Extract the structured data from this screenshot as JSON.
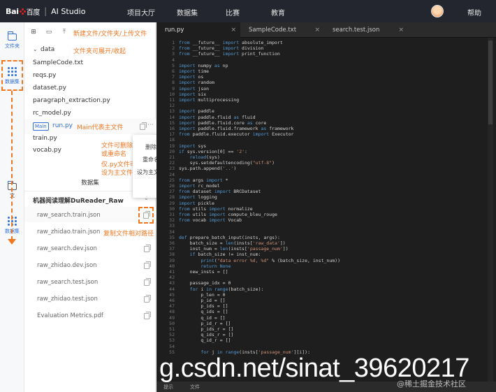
{
  "topbar": {
    "logo_text": "Bai",
    "logo_cn": "百度",
    "product": "AI Studio",
    "nav": [
      "项目大厅",
      "数据集",
      "比赛",
      "教育"
    ],
    "help": "帮助"
  },
  "rail": {
    "files_label": "文件夹",
    "dataset_label": "数据集",
    "files_label_2": "文",
    "dataset_label_2": "数据集"
  },
  "files": {
    "toolbar_note": "新建文件/文件夹/上传文件",
    "folder_name": "data",
    "folder_note": "文件夹可展开/收起",
    "items": [
      "SampleCode.txt",
      "reqs.py",
      "dataset.py",
      "paragraph_extraction.py",
      "rc_model.py"
    ],
    "main_badge": "Main",
    "main_file": "run.py",
    "main_note": "Main代表主文件",
    "items_after": [
      "train.py",
      "vocab.py"
    ],
    "rename_note": "文件可删除\n或重命名",
    "setmain_note": "仅.py文件可以\n设为主文件",
    "context_menu": [
      "删除",
      "重命名",
      "设为主文件"
    ],
    "dataset_header": "数据集",
    "dataset_name": "机器阅读理解DuReader_Raw",
    "dataset_files": [
      "raw_search.train.json",
      "raw_zhidao.train.json",
      "raw_search.dev.json",
      "raw_zhidao.dev.json",
      "raw_search.test.json",
      "raw_zhidao.test.json",
      "Evaluation Metrics.pdf"
    ],
    "copy_note": "复制文件相对路径"
  },
  "editor": {
    "tabs": [
      "run.py",
      "SampleCode.txt",
      "search.test.json"
    ],
    "status_left": "提示",
    "status_item": "文件"
  },
  "code_lines": [
    "from __future__ import absolute_import",
    "from __future__ import division",
    "from __future__ import print_function",
    "",
    "import numpy as np",
    "import time",
    "import os",
    "import random",
    "import json",
    "import six",
    "import multiprocessing",
    "",
    "import paddle",
    "import paddle.fluid as fluid",
    "import paddle.fluid.core as core",
    "import paddle.fluid.framework as framework",
    "from paddle.fluid.executor import Executor",
    "",
    "import sys",
    "if sys.version[0] == '2':",
    "    reload(sys)",
    "    sys.setdefaultencoding(\"utf-8\")",
    "sys.path.append('..')",
    "",
    "from args import *",
    "import rc_model",
    "from dataset import BRCDataset",
    "import logging",
    "import pickle",
    "from utils import normalize",
    "from utils import compute_bleu_rouge",
    "from vocab import Vocab",
    "",
    "",
    "def prepare_batch_input(insts, args):",
    "    batch_size = len(insts['raw_data'])",
    "    inst_num = len(insts['passage_num'])",
    "    if batch_size != inst_num:",
    "        print(\"data error %d, %d\" % (batch_size, inst_num))",
    "        return None",
    "    new_insts = []",
    "",
    "    passage_idx = 0",
    "    for i in range(batch_size):",
    "        p_len = 0",
    "        p_id = []",
    "        p_ids = []",
    "        q_ids = []",
    "        q_id = []",
    "        p_id_r = []",
    "        p_ids_r = []",
    "        q_ids_r = []",
    "        q_id_r = []",
    "",
    "        for j in range(insts['passage_num'][i]):"
  ],
  "watermark": "g.csdn.net/sinat_39620217",
  "watermark2": "@稀土掘金技术社区"
}
